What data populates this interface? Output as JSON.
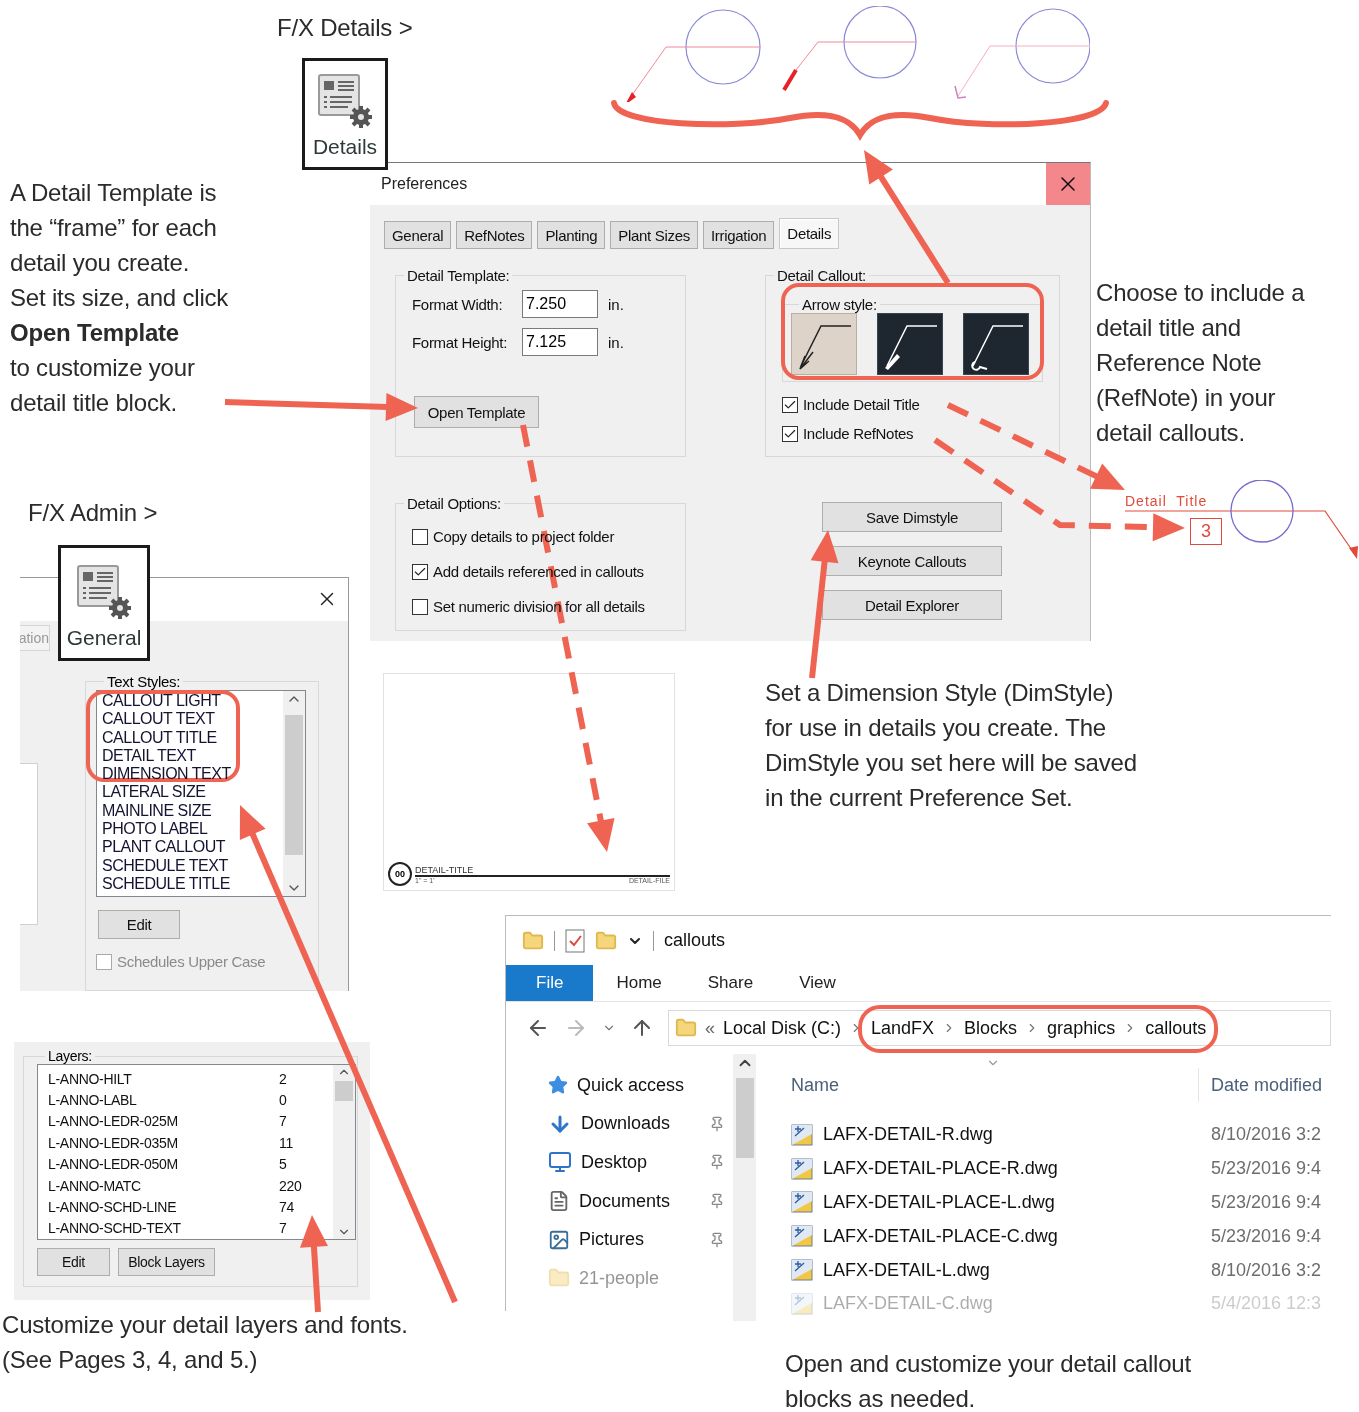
{
  "details_ribbon": {
    "caption": "F/X Details >",
    "label": "Details"
  },
  "intro_note": "A Detail Template is\nthe “frame” for each\ndetail you create.\nSet its size, and click\n**Open Template**\nto customize your\ndetail title block.",
  "preferences": {
    "title": "Preferences",
    "tabs": [
      {
        "label": "General",
        "selected": false
      },
      {
        "label": "RefNotes",
        "selected": false
      },
      {
        "label": "Planting",
        "selected": false
      },
      {
        "label": "Plant Sizes",
        "selected": false
      },
      {
        "label": "Irrigation",
        "selected": false
      },
      {
        "label": "Details",
        "selected": true
      }
    ],
    "detail_template": {
      "legend": "Detail Template:",
      "fields": [
        {
          "label": "Format Width:",
          "value": "7.250",
          "unit": "in."
        },
        {
          "label": "Format Height:",
          "value": "7.125",
          "unit": "in."
        }
      ],
      "button": "Open Template"
    },
    "detail_callout": {
      "legend": "Detail Callout:",
      "arrow_style_legend": "Arrow style:",
      "arrow_styles": [
        {
          "kind": "open",
          "selected": true
        },
        {
          "kind": "filled",
          "selected": false
        },
        {
          "kind": "loop",
          "selected": false
        }
      ],
      "options": [
        {
          "label": "Include Detail Title",
          "checked": true
        },
        {
          "label": "Include RefNotes",
          "checked": true
        }
      ]
    },
    "detail_options": {
      "legend": "Detail Options:",
      "options": [
        {
          "label": "Copy details to project folder",
          "checked": false
        },
        {
          "label": "Add details referenced in callouts",
          "checked": true
        },
        {
          "label": "Set numeric division for all details",
          "checked": false
        }
      ]
    },
    "buttons": [
      "Save Dimstyle",
      "Keynote Callouts",
      "Detail Explorer"
    ]
  },
  "template_preview": {
    "number": "00",
    "title": "DETAIL-TITLE",
    "scale": "1\" = 1'",
    "file": "DETAIL-FILE"
  },
  "callout_note": "Choose to include a\ndetail title and\nReference Note\n(RefNote) in your\ndetail callouts.",
  "callout_example": {
    "title": "Detail  Title",
    "number": "3"
  },
  "dimstyle_note": "Set a Dimension Style (DimStyle)\nfor use in details you create. The\nDimStyle you set here will be saved\nin the current Preference Set.",
  "admin_ribbon": {
    "caption": "F/X Admin >",
    "label": "General"
  },
  "general_dialog": {
    "tab": "ation",
    "text_styles": {
      "legend": "Text Styles:",
      "items": [
        "CALLOUT LIGHT",
        "CALLOUT TEXT",
        "CALLOUT TITLE",
        "DETAIL TEXT",
        "DIMENSION TEXT",
        "LATERAL SIZE",
        "MAINLINE SIZE",
        "PHOTO LABEL",
        "PLANT CALLOUT",
        "SCHEDULE TEXT",
        "SCHEDULE TITLE"
      ],
      "button": "Edit",
      "upper_case": {
        "label": "Schedules Upper Case",
        "checked": false,
        "disabled": true
      }
    }
  },
  "layers": {
    "legend": "Layers:",
    "rows": [
      {
        "name": "L-ANNO-HILT",
        "count": "2"
      },
      {
        "name": "L-ANNO-LABL",
        "count": "0"
      },
      {
        "name": "L-ANNO-LEDR-025M",
        "count": "7"
      },
      {
        "name": "L-ANNO-LEDR-035M",
        "count": "11"
      },
      {
        "name": "L-ANNO-LEDR-050M",
        "count": "5"
      },
      {
        "name": "L-ANNO-MATC",
        "count": "220"
      },
      {
        "name": "L-ANNO-SCHD-LINE",
        "count": "74"
      },
      {
        "name": "L-ANNO-SCHD-TEXT",
        "count": "7"
      }
    ],
    "buttons": [
      "Edit",
      "Block Layers"
    ]
  },
  "layers_note": "Customize your detail layers and fonts.\n(See Pages 3, 4, and 5.)",
  "explorer": {
    "title": "callouts",
    "ribbon_tabs": [
      {
        "label": "File",
        "selected": true
      },
      {
        "label": "Home",
        "selected": false
      },
      {
        "label": "Share",
        "selected": false
      },
      {
        "label": "View",
        "selected": false
      }
    ],
    "path_prefix": "«",
    "path": [
      "Local Disk (C:)",
      "LandFX",
      "Blocks",
      "graphics",
      "callouts"
    ],
    "nav": [
      {
        "kind": "star",
        "label": "Quick access",
        "pinned": false,
        "faded": false
      },
      {
        "kind": "download",
        "label": "Downloads",
        "pinned": true,
        "faded": false
      },
      {
        "kind": "desktop",
        "label": "Desktop",
        "pinned": true,
        "faded": false
      },
      {
        "kind": "document",
        "label": "Documents",
        "pinned": true,
        "faded": false
      },
      {
        "kind": "picture",
        "label": "Pictures",
        "pinned": true,
        "faded": false
      },
      {
        "kind": "folder",
        "label": "21-people",
        "pinned": false,
        "faded": true
      }
    ],
    "columns": [
      "Name",
      "Date modified"
    ],
    "files": [
      {
        "name": "LAFX-DETAIL-R.dwg",
        "date": "8/10/2016 3:2",
        "faded": false
      },
      {
        "name": "LAFX-DETAIL-PLACE-R.dwg",
        "date": "5/23/2016 9:4",
        "faded": false
      },
      {
        "name": "LAFX-DETAIL-PLACE-L.dwg",
        "date": "5/23/2016 9:4",
        "faded": false
      },
      {
        "name": "LAFX-DETAIL-PLACE-C.dwg",
        "date": "5/23/2016 9:4",
        "faded": false
      },
      {
        "name": "LAFX-DETAIL-L.dwg",
        "date": "8/10/2016 3:2",
        "faded": false
      },
      {
        "name": "LAFX-DETAIL-C.dwg",
        "date": "5/4/2016 12:3",
        "faded": true
      }
    ]
  },
  "explorer_note": "Open and customize your detail callout\nblocks as needed."
}
